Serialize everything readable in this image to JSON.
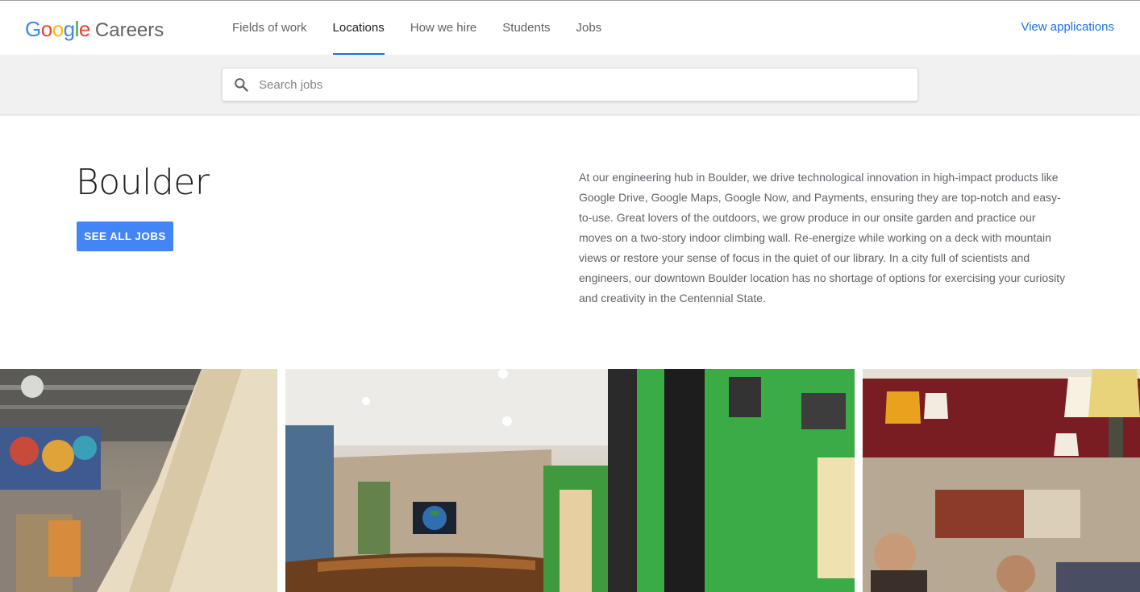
{
  "header": {
    "logo_google": "Google",
    "logo_careers": "Careers",
    "nav": [
      {
        "label": "Fields of work",
        "active": false
      },
      {
        "label": "Locations",
        "active": true
      },
      {
        "label": "How we hire",
        "active": false
      },
      {
        "label": "Students",
        "active": false
      },
      {
        "label": "Jobs",
        "active": false
      }
    ],
    "view_applications": "View applications"
  },
  "search": {
    "placeholder": "Search jobs",
    "icon": "search-icon"
  },
  "location": {
    "title": "Boulder",
    "button_label": "SEE ALL JOBS",
    "description": "At our engineering hub in Boulder, we drive technological innovation in high-impact products like Google Drive, Google Maps, Google Now, and Payments, ensuring they are top-notch and easy-to-use. Great lovers of the outdoors, we grow produce in our onsite garden and practice our moves on a two-story indoor climbing wall. Re-energize while working on a deck with mountain views or restore your sense of focus in the quiet of our library. In a city full of scientists and engineers, our downtown Boulder location has no shortage of options for exercising your curiosity and creativity in the Centennial State."
  },
  "colors": {
    "accent": "#1a73e8",
    "button": "#4285f4",
    "search_band": "#f1f1f1"
  }
}
